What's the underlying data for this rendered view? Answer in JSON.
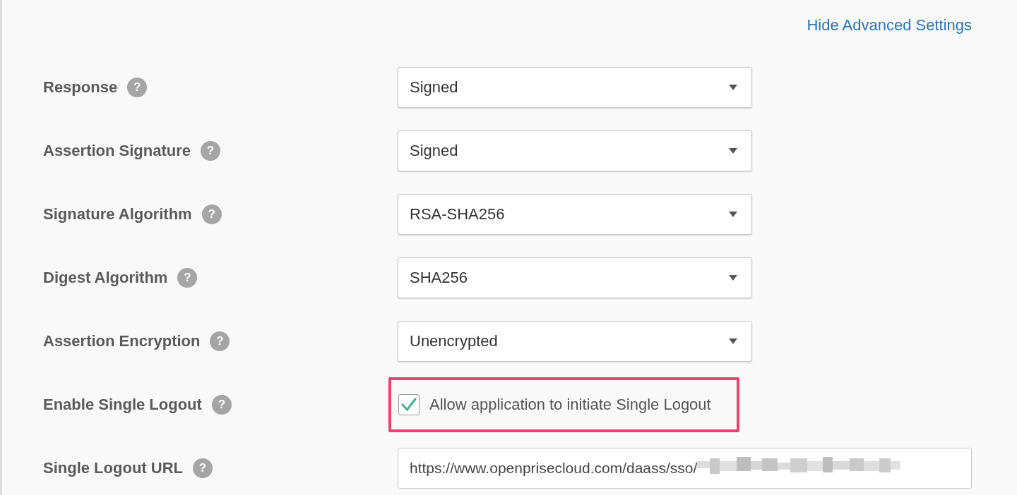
{
  "advanced_link": "Hide Advanced Settings",
  "settings": [
    {
      "kind": "select",
      "label": "Response",
      "help": "?",
      "value": "Signed"
    },
    {
      "kind": "select",
      "label": "Assertion Signature",
      "help": "?",
      "value": "Signed"
    },
    {
      "kind": "select",
      "label": "Signature Algorithm",
      "help": "?",
      "value": "RSA-SHA256"
    },
    {
      "kind": "select",
      "label": "Digest Algorithm",
      "help": "?",
      "value": "SHA256"
    },
    {
      "kind": "select",
      "label": "Assertion Encryption",
      "help": "?",
      "value": "Unencrypted"
    },
    {
      "kind": "checkbox",
      "label": "Enable Single Logout",
      "help": "?",
      "option": "Allow application to initiate Single Logout",
      "checked": true,
      "highlighted": true
    },
    {
      "kind": "text",
      "label": "Single Logout URL",
      "help": "?",
      "value": "https://www.openprisecloud.com/daass/sso/",
      "redacted": true
    }
  ]
}
